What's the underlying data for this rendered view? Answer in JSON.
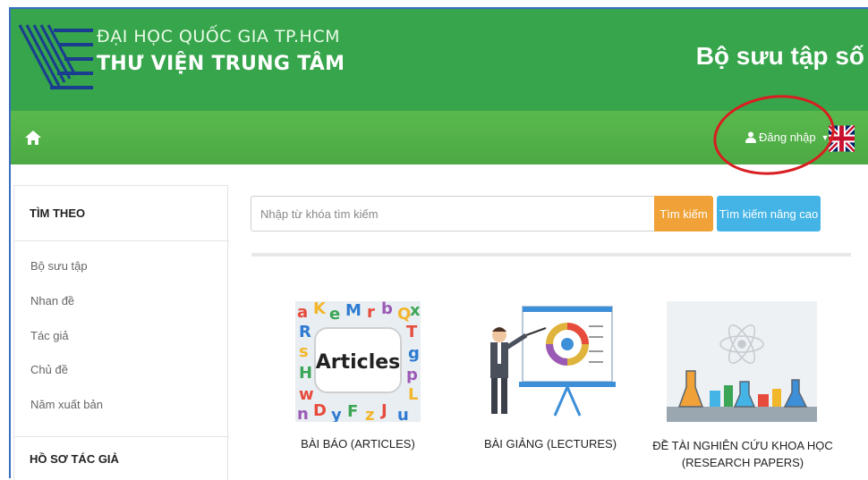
{
  "header": {
    "university": "ĐẠI HỌC QUỐC GIA TP.HCM",
    "library": "THƯ VIỆN TRUNG TÂM",
    "collection_title": "Bộ sưu tập số"
  },
  "navbar": {
    "login_label": "Đăng nhập"
  },
  "sidebar": {
    "section1_title": "TÌM THEO",
    "items": [
      "Bộ sưu tập",
      "Nhan đề",
      "Tác giả",
      "Chủ đề",
      "Năm xuất bản"
    ],
    "section2_title": "HỒ SƠ TÁC GIẢ"
  },
  "search": {
    "placeholder": "Nhập từ khóa tìm kiếm",
    "button_label": "Tìm kiếm",
    "advanced_label": "Tìm kiếm nâng cao"
  },
  "collections": [
    {
      "label": "BÀI BÁO (ARTICLES)",
      "image_text": "Articles"
    },
    {
      "label": "BÀI GIẢNG (LECTURES)"
    },
    {
      "label_line1": "ĐỀ TÀI NGHIÊN CỨU KHOA HỌC",
      "label_line2": "(RESEARCH PAPERS)"
    }
  ],
  "colors": {
    "banner": "#36a54b",
    "navbar": "#4ca944",
    "search_button": "#f0a238",
    "advanced_button": "#44b4e6",
    "annotation_circle": "#d91d20"
  }
}
